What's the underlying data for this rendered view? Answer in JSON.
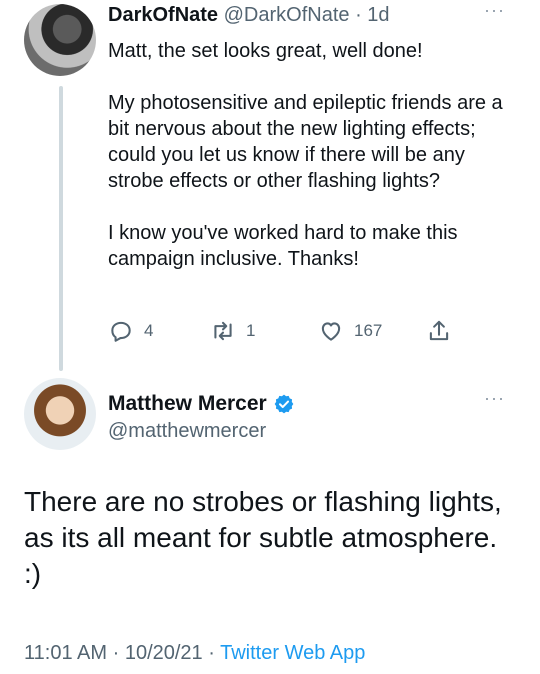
{
  "reply": {
    "display_name": "DarkOfNate",
    "handle": "@DarkOfNate",
    "separator": "·",
    "time": "1d",
    "more": "···",
    "paragraphs": [
      "Matt, the set looks great, well done!",
      "My photosensitive and epileptic friends are a bit nervous about the new lighting effects; could you let us know if there will be any strobe effects or other flashing lights?",
      "I know you've worked hard to make this campaign inclusive. Thanks!"
    ],
    "actions": {
      "reply_count": "4",
      "retweet_count": "1",
      "like_count": "167"
    }
  },
  "main": {
    "display_name": "Matthew Mercer",
    "handle": "@matthewmercer",
    "more": "···",
    "text": "There are no strobes or flashing lights, as its all meant for subtle atmosphere. :)",
    "time": "11:01 AM",
    "separator": "·",
    "date": "10/20/21",
    "app": "Twitter Web App"
  },
  "colors": {
    "accent": "#1d9bf0",
    "muted": "#536471",
    "thread_line": "#cfd9de",
    "text": "#0f1419"
  },
  "icons": [
    "reply-icon",
    "retweet-icon",
    "like-icon",
    "share-icon",
    "verified-badge-icon",
    "more-icon"
  ]
}
